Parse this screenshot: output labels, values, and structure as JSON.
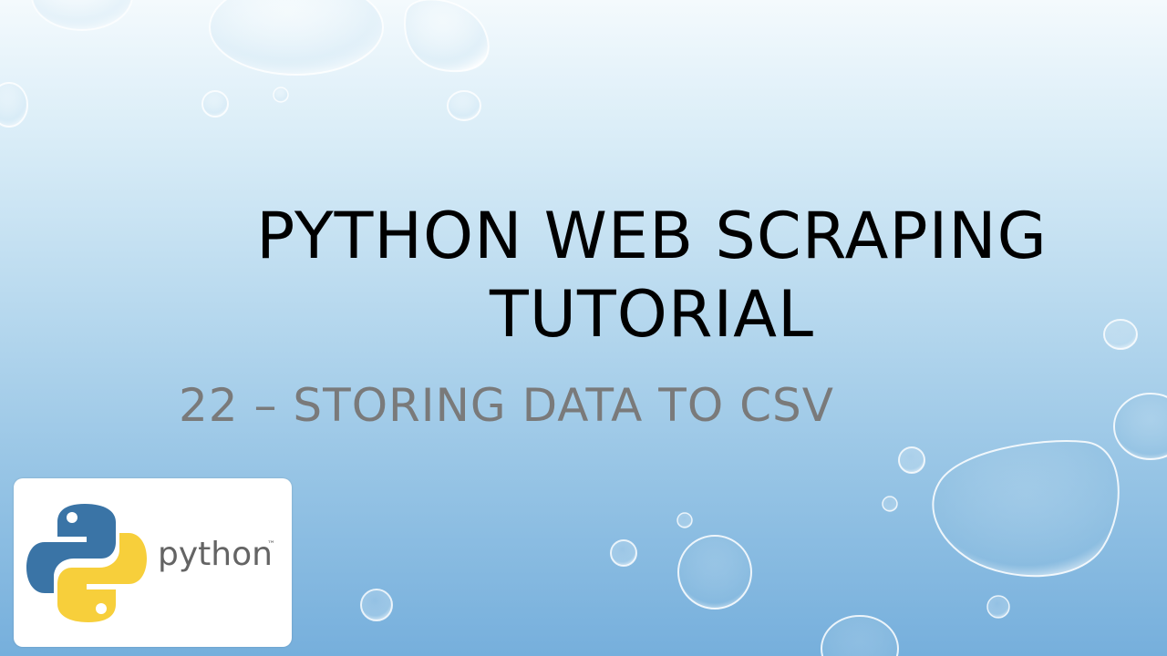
{
  "slide": {
    "title_lines": [
      "PYTHON WEB SCRAPING",
      "TUTORIAL"
    ],
    "subtitle": "22 – STORING DATA TO CSV",
    "colors": {
      "title": "#000000",
      "subtitle": "#7a7a7a",
      "python_blue": "#3a74a6",
      "python_yellow": "#f7cf3b",
      "logo_text": "#646464"
    }
  },
  "logo": {
    "word": "python",
    "tm": "™",
    "icon": "python-logo-icon"
  },
  "decor": {
    "icon": "water-bubbles"
  }
}
